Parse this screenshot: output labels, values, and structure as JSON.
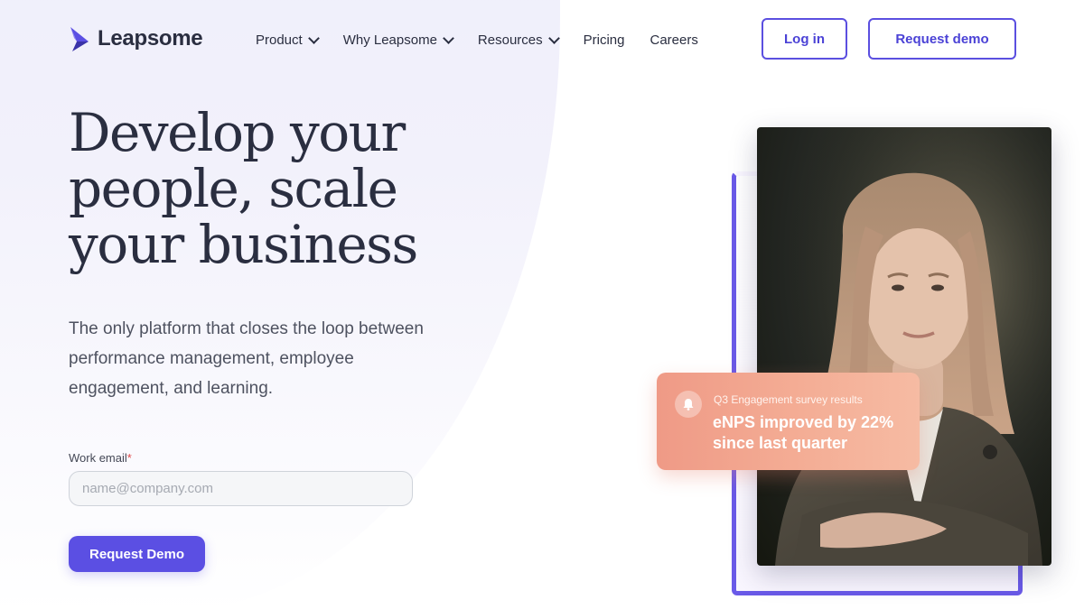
{
  "brand": {
    "name": "Leapsome",
    "accent": "#5b4fe3",
    "text_dark": "#2a2e40",
    "card_color": "#f2a58f"
  },
  "nav": {
    "items": [
      {
        "label": "Product",
        "has_dropdown": true
      },
      {
        "label": "Why Leapsome",
        "has_dropdown": true
      },
      {
        "label": "Resources",
        "has_dropdown": true
      },
      {
        "label": "Pricing",
        "has_dropdown": false
      },
      {
        "label": "Careers",
        "has_dropdown": false
      }
    ],
    "login_label": "Log in",
    "demo_label": "Request demo"
  },
  "hero": {
    "headline_line1": "Develop your",
    "headline_line2": "people, scale",
    "headline_line3": "your business",
    "subtext": "The only platform that closes the loop between performance management, employee engagement, and learning.",
    "email_label": "Work email",
    "email_required_marker": "*",
    "email_placeholder": "name@company.com",
    "email_value": "",
    "cta_label": "Request Demo"
  },
  "notification": {
    "icon": "bell-icon",
    "caption": "Q3 Engagement survey results",
    "title": "eNPS improved by 22% since last quarter"
  }
}
